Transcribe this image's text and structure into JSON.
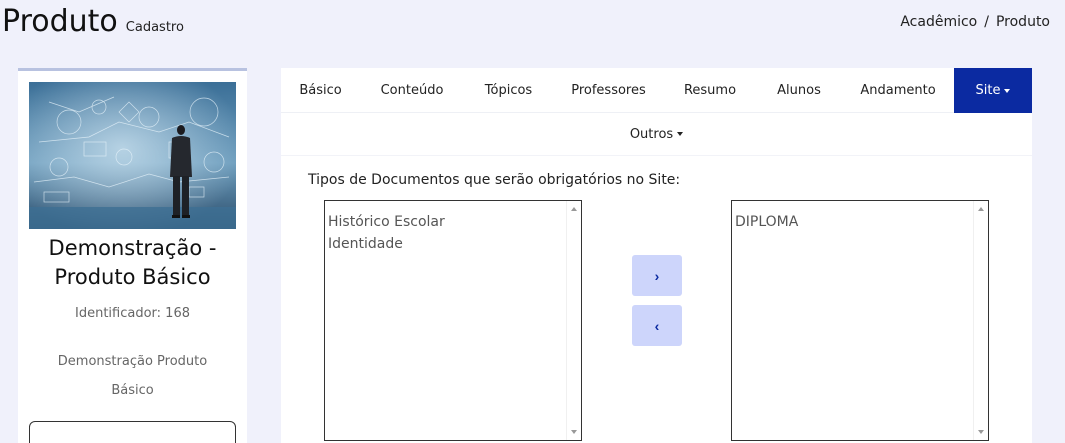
{
  "header": {
    "title": "Produto",
    "subtitle": "Cadastro",
    "breadcrumb": [
      "Acadêmico",
      "Produto"
    ]
  },
  "sidebar": {
    "name": "Demonstração - Produto Básico",
    "identifier": "Identificador: 168",
    "description": "Demonstração Produto Básico"
  },
  "tabs": [
    {
      "label": "Básico"
    },
    {
      "label": "Conteúdo"
    },
    {
      "label": "Tópicos"
    },
    {
      "label": "Professores"
    },
    {
      "label": "Resumo"
    },
    {
      "label": "Alunos"
    },
    {
      "label": "Andamento"
    },
    {
      "label": "Site",
      "active": true
    },
    {
      "label": "Outros"
    }
  ],
  "documents": {
    "label": "Tipos de Documentos que serão obrigatórios no Site:",
    "available": [
      "Histórico Escolar",
      "Identidade"
    ],
    "selected": [
      "DIPLOMA"
    ],
    "move_right": "›",
    "move_left": "‹"
  },
  "colors": {
    "accent": "#0b2aa1",
    "button_bg": "#cdd5fb",
    "page_bg": "#f0f1fb"
  }
}
